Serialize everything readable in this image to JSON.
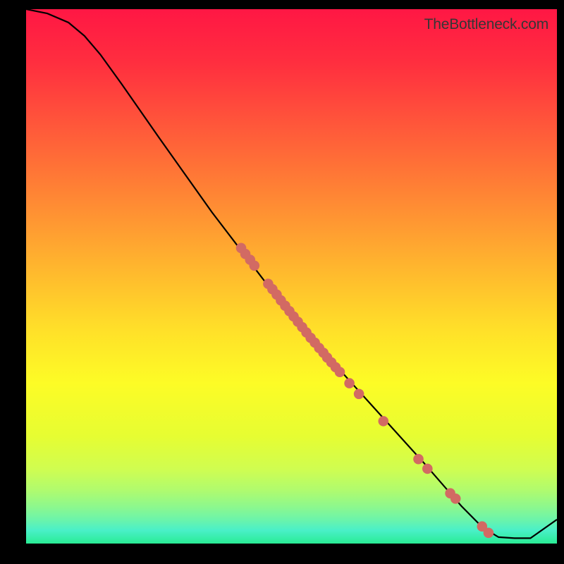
{
  "watermark": "TheBottleneck.com",
  "chart_data": {
    "type": "line",
    "title": "",
    "xlabel": "",
    "ylabel": "",
    "xlim": [
      0,
      100
    ],
    "ylim": [
      0,
      100
    ],
    "curve": [
      {
        "x": 0,
        "y": 100
      },
      {
        "x": 4,
        "y": 99.2
      },
      {
        "x": 8,
        "y": 97.5
      },
      {
        "x": 11,
        "y": 95
      },
      {
        "x": 14,
        "y": 91.5
      },
      {
        "x": 18,
        "y": 86
      },
      {
        "x": 25,
        "y": 76
      },
      {
        "x": 35,
        "y": 62
      },
      {
        "x": 45,
        "y": 49
      },
      {
        "x": 55,
        "y": 37
      },
      {
        "x": 65,
        "y": 26
      },
      {
        "x": 75,
        "y": 15
      },
      {
        "x": 82,
        "y": 7
      },
      {
        "x": 86,
        "y": 3
      },
      {
        "x": 89,
        "y": 1.2
      },
      {
        "x": 92,
        "y": 1.0
      },
      {
        "x": 95,
        "y": 1.0
      },
      {
        "x": 100,
        "y": 4.5
      }
    ],
    "markers": [
      {
        "x": 40.5,
        "y": 55.3
      },
      {
        "x": 41.3,
        "y": 54.2
      },
      {
        "x": 42.2,
        "y": 53.1
      },
      {
        "x": 43.0,
        "y": 52.0
      },
      {
        "x": 45.6,
        "y": 48.6
      },
      {
        "x": 46.4,
        "y": 47.6
      },
      {
        "x": 47.2,
        "y": 46.6
      },
      {
        "x": 48.0,
        "y": 45.5
      },
      {
        "x": 48.8,
        "y": 44.5
      },
      {
        "x": 49.6,
        "y": 43.5
      },
      {
        "x": 50.4,
        "y": 42.5
      },
      {
        "x": 51.2,
        "y": 41.5
      },
      {
        "x": 52.0,
        "y": 40.5
      },
      {
        "x": 52.8,
        "y": 39.5
      },
      {
        "x": 53.6,
        "y": 38.5
      },
      {
        "x": 54.4,
        "y": 37.6
      },
      {
        "x": 55.2,
        "y": 36.6
      },
      {
        "x": 56.0,
        "y": 35.7
      },
      {
        "x": 56.7,
        "y": 34.8
      },
      {
        "x": 57.5,
        "y": 33.9
      },
      {
        "x": 58.3,
        "y": 33.0
      },
      {
        "x": 59.1,
        "y": 32.1
      },
      {
        "x": 60.9,
        "y": 30.0
      },
      {
        "x": 62.7,
        "y": 28.0
      },
      {
        "x": 67.3,
        "y": 22.9
      },
      {
        "x": 73.9,
        "y": 15.8
      },
      {
        "x": 75.6,
        "y": 14.0
      },
      {
        "x": 79.9,
        "y": 9.4
      },
      {
        "x": 80.9,
        "y": 8.4
      },
      {
        "x": 85.9,
        "y": 3.2
      },
      {
        "x": 87.1,
        "y": 2.0
      }
    ],
    "gradient_stops": [
      {
        "offset": 0.0,
        "color": "#ff1744"
      },
      {
        "offset": 0.1,
        "color": "#ff2e3f"
      },
      {
        "offset": 0.2,
        "color": "#ff513b"
      },
      {
        "offset": 0.3,
        "color": "#ff7436"
      },
      {
        "offset": 0.4,
        "color": "#ff9832"
      },
      {
        "offset": 0.5,
        "color": "#ffbc2d"
      },
      {
        "offset": 0.6,
        "color": "#ffe029"
      },
      {
        "offset": 0.7,
        "color": "#fdfc26"
      },
      {
        "offset": 0.8,
        "color": "#e6fd32"
      },
      {
        "offset": 0.86,
        "color": "#d0fd50"
      },
      {
        "offset": 0.9,
        "color": "#b0fb6e"
      },
      {
        "offset": 0.93,
        "color": "#8ef88c"
      },
      {
        "offset": 0.955,
        "color": "#6cf4aa"
      },
      {
        "offset": 0.975,
        "color": "#4af0c8"
      },
      {
        "offset": 1.0,
        "color": "#29ec94"
      }
    ],
    "marker_color": "#d26a63",
    "curve_color": "#000000"
  }
}
